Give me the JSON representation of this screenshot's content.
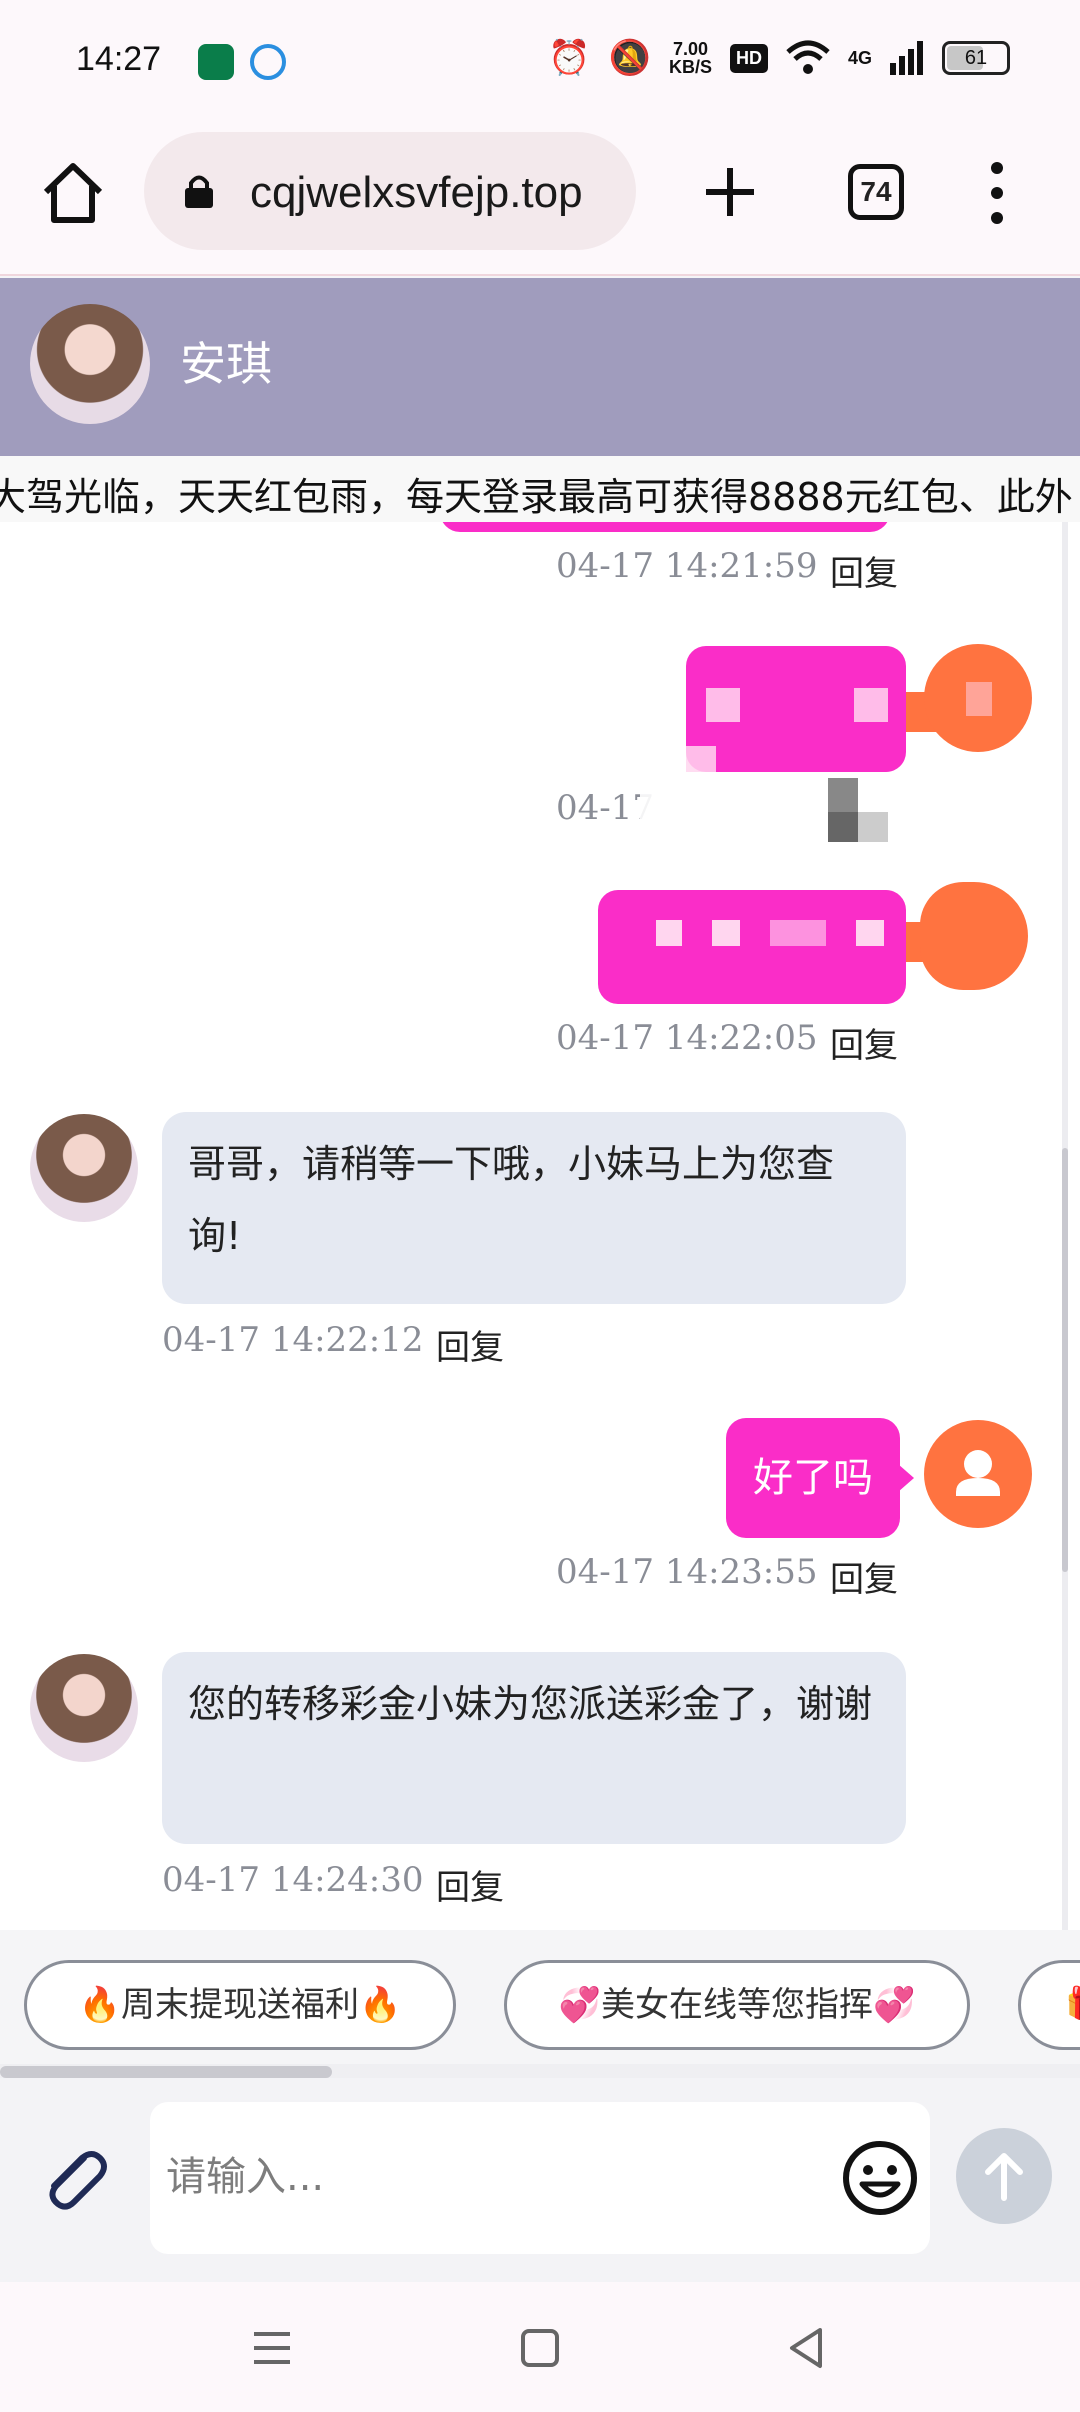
{
  "status_bar": {
    "time": "14:27",
    "speed_top": "7.00",
    "speed_unit": "KB/S",
    "hd": "HD",
    "network": "4G",
    "battery": "61"
  },
  "browser": {
    "url": "cqjwelxsvfejp.top",
    "tab_count": "74"
  },
  "chat": {
    "name": "安琪",
    "marquee": "大驾光临，天天红包雨，每天登录最高可获得8888元红包、此外",
    "messages": [
      {
        "side": "me",
        "text": "",
        "time": "04-17 14:21:59",
        "reply": "回复"
      },
      {
        "side": "me",
        "text": "",
        "time": "04-17",
        "reply": ""
      },
      {
        "side": "me",
        "text": "",
        "time": "04-17 14:22:05",
        "reply": "回复"
      },
      {
        "side": "her",
        "text": "哥哥，请稍等一下哦，小妹马上为您查询!",
        "time": "04-17 14:22:12",
        "reply": "回复"
      },
      {
        "side": "me",
        "text": "好了吗",
        "time": "04-17 14:23:55",
        "reply": "回复"
      },
      {
        "side": "her",
        "text": "您的转移彩金小妹为您派送彩金了，谢谢",
        "time": "04-17 14:24:30",
        "reply": "回复"
      }
    ]
  },
  "quick_replies": [
    "🔥周末提现送福利🔥",
    "💞美女在线等您指挥💞",
    "🎁"
  ],
  "input": {
    "placeholder": "请输入..."
  },
  "colors": {
    "header_bg": "#a09cbd",
    "my_bubble": "#fa2dc8",
    "my_avatar": "#ff7340",
    "her_bubble": "#e5e9f2"
  }
}
